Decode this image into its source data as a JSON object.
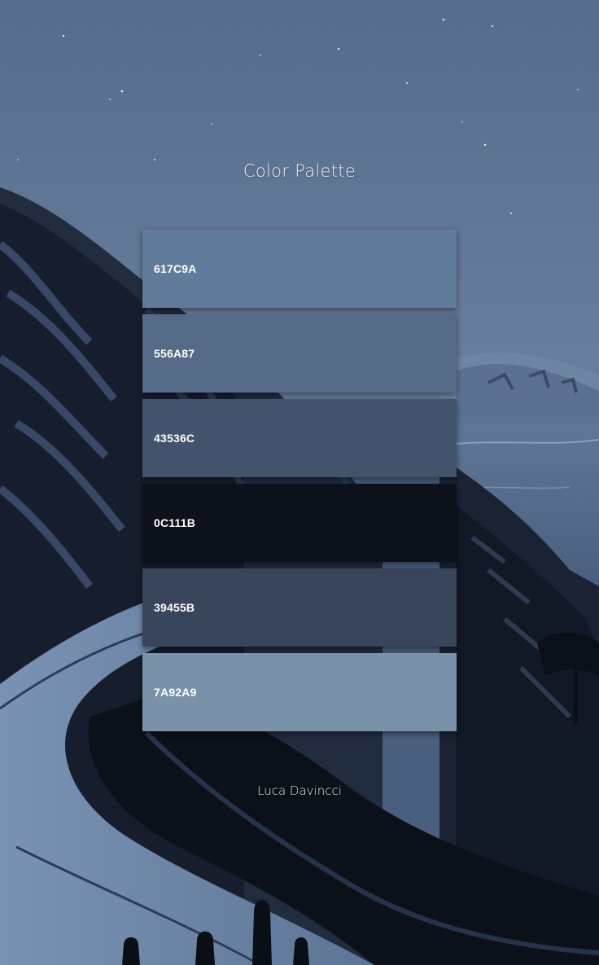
{
  "title": "Color Palette",
  "author": "Luca Davincci",
  "swatches": [
    {
      "hex": "617C9A",
      "color": "#617C9A"
    },
    {
      "hex": "556A87",
      "color": "#556A87"
    },
    {
      "hex": "43536C",
      "color": "#43536C"
    },
    {
      "hex": "0C111B",
      "color": "#0C111B"
    },
    {
      "hex": "39455B",
      "color": "#39455B"
    },
    {
      "hex": "7A92A9",
      "color": "#7A92A9"
    }
  ]
}
